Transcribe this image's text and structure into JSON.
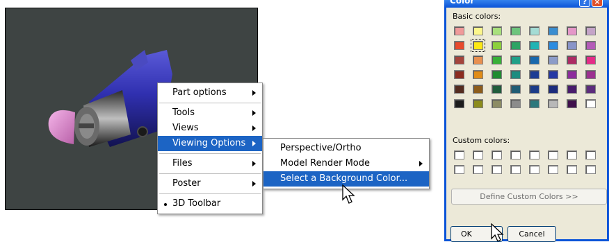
{
  "context_menu": {
    "items": [
      {
        "label": "Part options",
        "submenu": true
      },
      {
        "label": "Tools",
        "submenu": true
      },
      {
        "label": "Views",
        "submenu": true
      },
      {
        "label": "Viewing Options",
        "submenu": true,
        "highlighted": true
      },
      {
        "label": "Files",
        "submenu": true
      },
      {
        "label": "Poster",
        "submenu": true
      },
      {
        "label": "3D Toolbar",
        "checked": true
      }
    ]
  },
  "submenu": {
    "items": [
      {
        "label": "Perspective/Ortho"
      },
      {
        "label": "Model Render Mode",
        "submenu": true
      },
      {
        "label": "Select a Background Color...",
        "highlighted": true
      }
    ]
  },
  "color_dialog": {
    "title": "Color",
    "help_symbol": "?",
    "close_symbol": "×",
    "basic_colors_label": "Basic colors:",
    "custom_colors_label": "Custom colors:",
    "define_custom_button": "Define Custom Colors >>",
    "ok_button": "OK",
    "cancel_button": "Cancel",
    "basic_colors": [
      "#f09a9a",
      "#fcf68c",
      "#a8e07c",
      "#6cc47c",
      "#a4dcd4",
      "#3a8ed0",
      "#e497c8",
      "#c4a4c8",
      "#e84a2c",
      "#fce814",
      "#8cd03c",
      "#2ca464",
      "#20b4b4",
      "#2c8ce0",
      "#8894c8",
      "#b45cb8",
      "#a4443c",
      "#e89050",
      "#38b038",
      "#20a088",
      "#1868ac",
      "#8c9cc8",
      "#ac2c64",
      "#e42c88",
      "#8c2c20",
      "#e08c18",
      "#208c30",
      "#1c8c80",
      "#1c3c94",
      "#2438a4",
      "#8c2c9c",
      "#9c3090",
      "#542c20",
      "#8c5c1c",
      "#205c3c",
      "#205c74",
      "#1c3c88",
      "#1c2c7c",
      "#481c6c",
      "#5c2c7c",
      "#1c1c1c",
      "#8c8c1c",
      "#8c8c64",
      "#8c8c8c",
      "#2c787c",
      "#b8b8b8",
      "#40104c",
      "#ffffff"
    ],
    "selected_color": "#fce814",
    "custom_colors": [
      "#ffffff",
      "#ffffff",
      "#ffffff",
      "#ffffff",
      "#ffffff",
      "#ffffff",
      "#ffffff",
      "#ffffff",
      "#ffffff",
      "#ffffff",
      "#ffffff",
      "#ffffff",
      "#ffffff",
      "#ffffff",
      "#ffffff",
      "#ffffff"
    ]
  },
  "colors": {
    "viewport_background": "#3e4443",
    "menu_highlight": "#1c64c4",
    "dialog_background": "#ece9d8",
    "title_bar": "#0a53d8"
  }
}
